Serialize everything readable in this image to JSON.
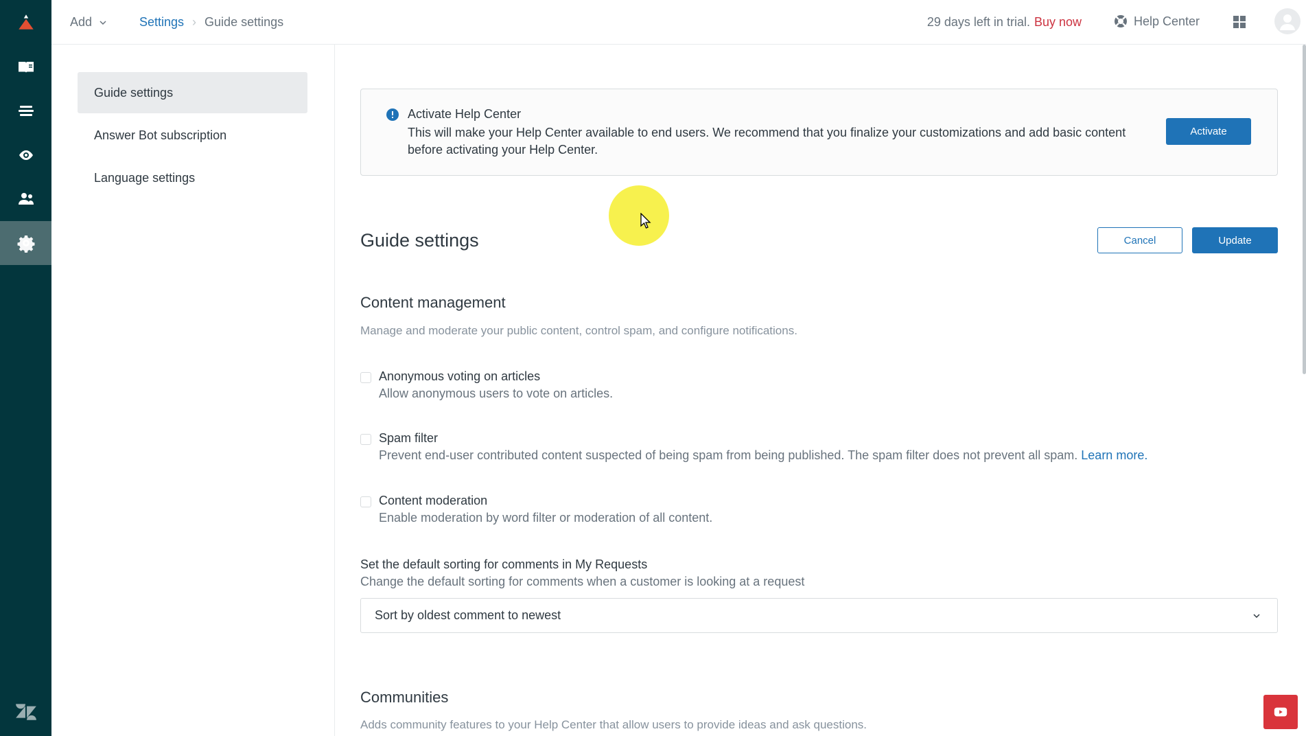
{
  "header": {
    "add_label": "Add",
    "breadcrumb": {
      "parent": "Settings",
      "current": "Guide settings"
    },
    "trial_text": "29 days left in trial.",
    "buy_now": "Buy now",
    "help_center": "Help Center"
  },
  "sidemenu": {
    "items": [
      {
        "label": "Guide settings",
        "active": true
      },
      {
        "label": "Answer Bot subscription",
        "active": false
      },
      {
        "label": "Language settings",
        "active": false
      }
    ]
  },
  "banner": {
    "title": "Activate Help Center",
    "text": "This will make your Help Center available to end users. We recommend that you finalize your customizations and add basic content before activating your Help Center.",
    "activate_label": "Activate"
  },
  "page": {
    "title": "Guide settings",
    "cancel_label": "Cancel",
    "update_label": "Update"
  },
  "content_management": {
    "title": "Content management",
    "description": "Manage and moderate your public content, control spam, and configure notifications.",
    "options": [
      {
        "label": "Anonymous voting on articles",
        "description": "Allow anonymous users to vote on articles.",
        "checked": false
      },
      {
        "label": "Spam filter",
        "description": "Prevent end-user contributed content suspected of being spam from being published. The spam filter does not prevent all spam.",
        "link": "Learn more.",
        "checked": false
      },
      {
        "label": "Content moderation",
        "description": "Enable moderation by word filter or moderation of all content.",
        "checked": false
      }
    ],
    "sorting_label": "Set the default sorting for comments in My Requests",
    "sorting_desc": "Change the default sorting for comments when a customer is looking at a request",
    "sorting_value": "Sort by oldest comment to newest"
  },
  "communities": {
    "title": "Communities",
    "description": "Adds community features to your Help Center that allow users to provide ideas and ask questions."
  },
  "colors": {
    "rail": "#03363d",
    "primary": "#1f73b7",
    "buy_now": "#cc3340"
  }
}
